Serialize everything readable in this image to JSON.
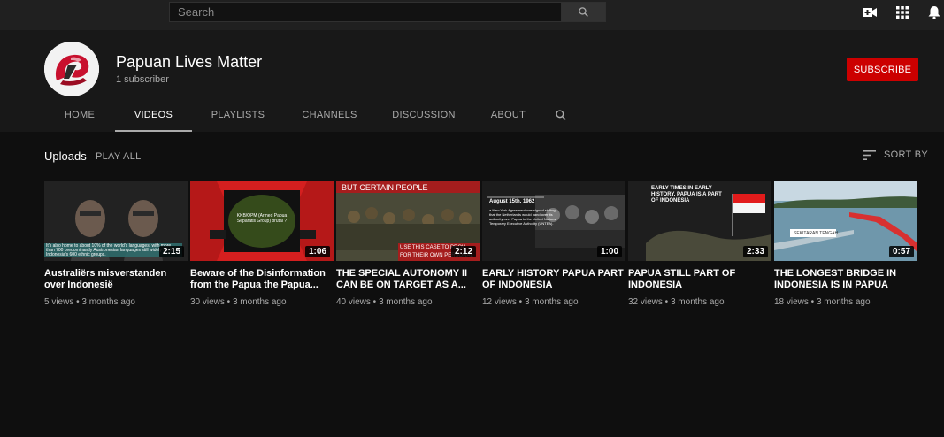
{
  "search": {
    "placeholder": "Search"
  },
  "topbar_icons": [
    "create-video-icon",
    "apps-grid-icon",
    "notifications-bell-icon"
  ],
  "channel": {
    "name": "Papuan Lives Matter",
    "subscribers": "1 subscriber",
    "subscribe_label": "SUBSCRIBE"
  },
  "tabs": [
    {
      "label": "HOME",
      "active": false
    },
    {
      "label": "VIDEOS",
      "active": true
    },
    {
      "label": "PLAYLISTS",
      "active": false
    },
    {
      "label": "CHANNELS",
      "active": false
    },
    {
      "label": "DISCUSSION",
      "active": false
    },
    {
      "label": "ABOUT",
      "active": false
    }
  ],
  "uploads": {
    "label": "Uploads",
    "play_all": "PLAY ALL",
    "sort_by": "SORT BY"
  },
  "videos": [
    {
      "title": "Australiërs misverstanden over Indonesië",
      "meta": "5 views • 3 months ago",
      "duration": "2:15",
      "thumb_text": "It's also home to about 10% of the world's languages, with more than 700 predominantly Austronesian languages still widely spoken. Indonesia's 600 ethnic groups."
    },
    {
      "title": "Beware of the Disinformation from the Papua the Papua...",
      "meta": "30 views • 3 months ago",
      "duration": "1:06",
      "thumb_text": "KKB/OPM (Armed Papua Separatis Group) brutal ?"
    },
    {
      "title": "THE SPECIAL AUTONOMY II CAN BE ON TARGET AS A...",
      "meta": "40 views • 3 months ago",
      "duration": "2:12",
      "thumb_text": "BUT CERTAIN PEOPLE",
      "thumb_text_2": "USE THIS CASE TO PROV",
      "thumb_text_3": "FOR THEIR OWN PERSONAL"
    },
    {
      "title": "EARLY HISTORY PAPUA PART OF INDONESIA",
      "meta": "12 views • 3 months ago",
      "duration": "1:00",
      "thumb_text": "August 15th, 1962",
      "thumb_text_2": "a New York Agreement was signed stating that the Netherlands would hand over its authority over Papua to the United Nations Temporary Executive Authority (UNTEA)."
    },
    {
      "title": "PAPUA STILL PART OF INDONESIA",
      "meta": "32 views • 3 months ago",
      "duration": "2:33",
      "thumb_text": "EARLY TIMES IN EARLY HISTORY, PAPUA IS A PART OF INDONESIA"
    },
    {
      "title": "THE LONGEST BRIDGE IN INDONESIA IS IN PAPUA",
      "meta": "18 views • 3 months ago",
      "duration": "0:57",
      "thumb_text": "SEKITARAN TENGAH"
    }
  ]
}
